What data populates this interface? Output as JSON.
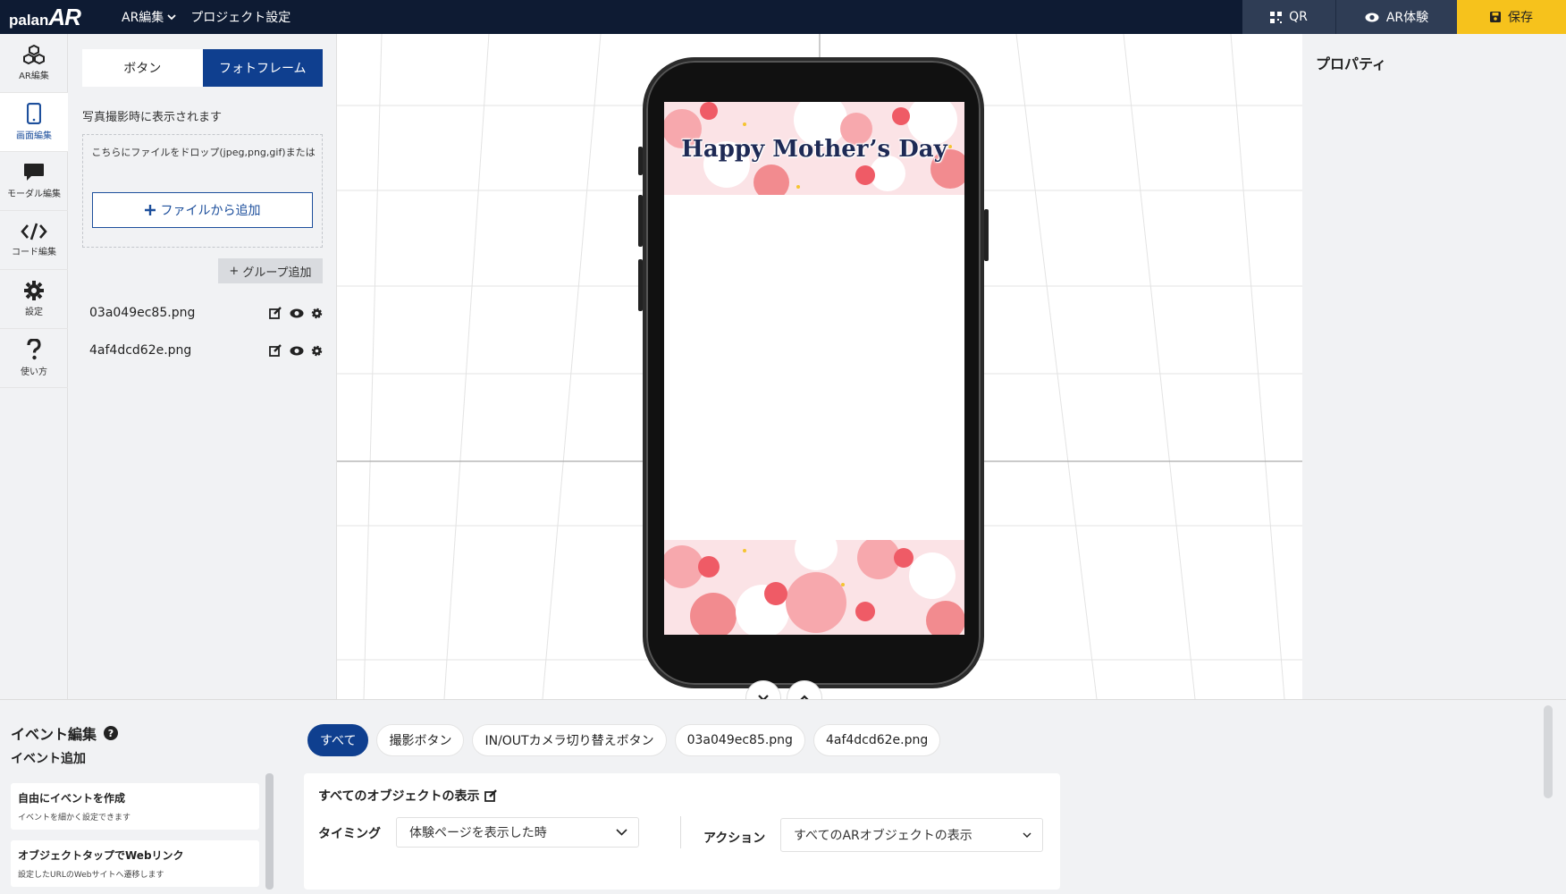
{
  "topbar": {
    "logo_small": "palan",
    "logo_big": "AR",
    "menu": [
      {
        "label": "AR編集"
      },
      {
        "label": "プロジェクト設定"
      }
    ],
    "qr_label": "QR",
    "ar_label": "AR体験",
    "save_label": "保存",
    "save_color": "#f6c21c",
    "bar_color": "#0e1b33"
  },
  "sidebar": {
    "items": [
      {
        "label": "AR編集",
        "icon": "cubes-icon"
      },
      {
        "label": "画面編集",
        "icon": "smartphone-icon",
        "active": true
      },
      {
        "label": "モーダル編集",
        "icon": "speech-bubble-icon"
      },
      {
        "label": "コード編集",
        "icon": "code-icon"
      },
      {
        "label": "設定",
        "icon": "gear-icon"
      },
      {
        "label": "使い方",
        "icon": "question-icon"
      }
    ]
  },
  "panel": {
    "tabs": [
      {
        "label": "ボタン"
      },
      {
        "label": "フォトフレーム",
        "active": true
      }
    ],
    "hint": "写真撮影時に表示されます",
    "drop_text": "こちらにファイルをドロップ(jpeg,png,gif)または",
    "add_file_label": "ファイルから追加",
    "add_group_label": "グループ追加",
    "layers": [
      {
        "name": "03a049ec85.png"
      },
      {
        "name": "4af4dcd62e.png"
      }
    ]
  },
  "canvas": {
    "frame_title": "Happy Mother’s Day"
  },
  "properties": {
    "title": "プロパティ"
  },
  "events": {
    "title": "イベント編集",
    "add_title": "イベント追加",
    "cards": [
      {
        "title": "自由にイベントを作成",
        "sub": "イベントを細かく設定できます"
      },
      {
        "title": "オブジェクトタップでWebリンク",
        "sub": "設定したURLのWebサイトへ遷移します"
      }
    ],
    "filters": [
      {
        "label": "すべて",
        "active": true
      },
      {
        "label": "撮影ボタン"
      },
      {
        "label": "IN/OUTカメラ切り替えボタン"
      },
      {
        "label": "03a049ec85.png"
      },
      {
        "label": "4af4dcd62e.png"
      }
    ],
    "box_title": "すべてのオブジェクトの表示",
    "timing_label": "タイミング",
    "timing_value": "体験ページを表示した時",
    "action_label": "アクション",
    "action_value": "すべてのARオブジェクトの表示"
  }
}
